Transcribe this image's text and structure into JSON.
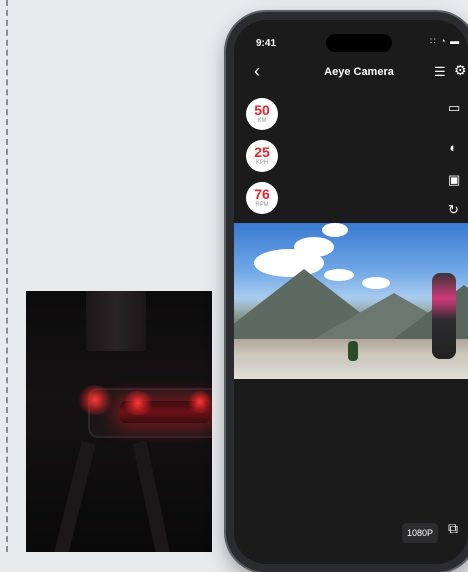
{
  "status": {
    "time": "9:41",
    "indicators": "∷ ◔ ▬"
  },
  "header": {
    "title": "Aeye Camera",
    "back": "‹",
    "menu": "☰",
    "settings": "⚙"
  },
  "gauges": [
    {
      "value": "50",
      "unit": "KM"
    },
    {
      "value": "25",
      "unit": "KPH"
    },
    {
      "value": "76",
      "unit": "RPM"
    }
  ],
  "side_controls": [
    {
      "name": "battery-icon",
      "glyph": "▭"
    },
    {
      "name": "light-icon",
      "glyph": "◖"
    },
    {
      "name": "camera-icon",
      "glyph": "▣"
    },
    {
      "name": "rotate-icon",
      "glyph": "↻"
    }
  ],
  "footer": {
    "resolution": "1080P",
    "expand": "⧉"
  },
  "colors": {
    "accent": "#e8242b",
    "screen_bg": "#1b1b1c"
  }
}
